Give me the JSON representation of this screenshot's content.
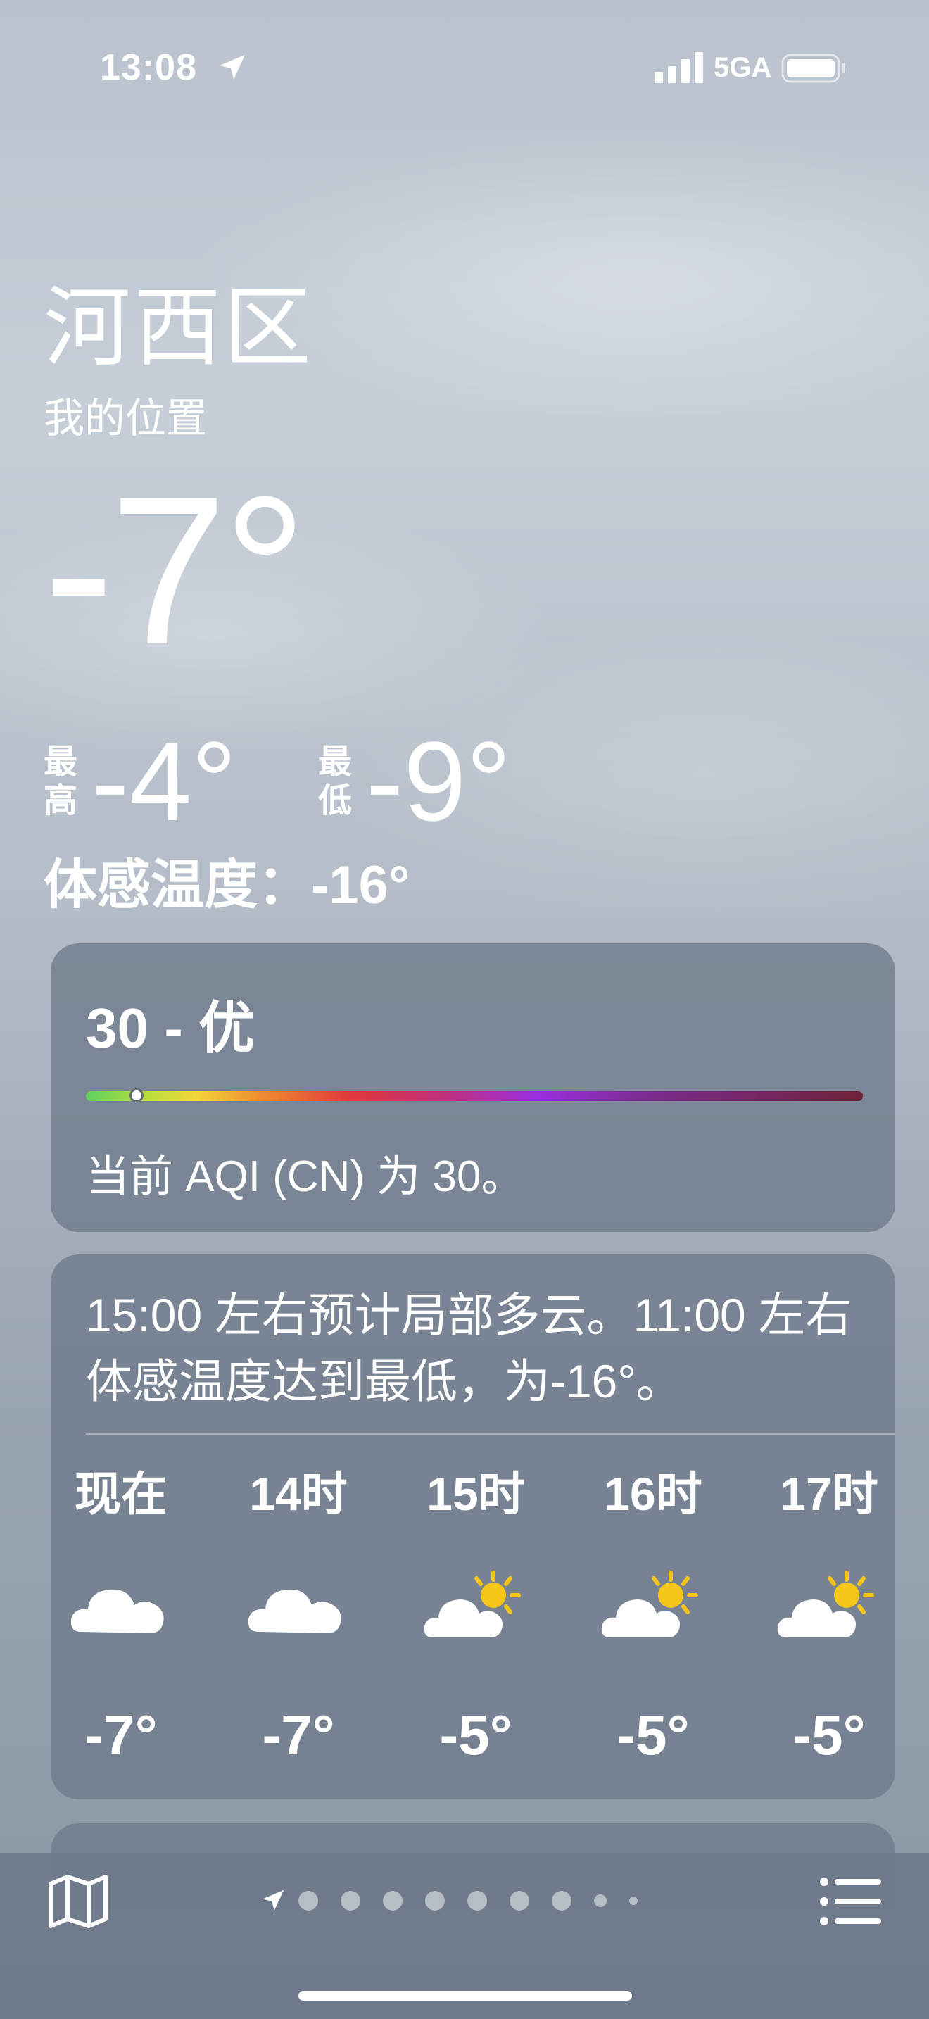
{
  "status_bar": {
    "time": "13:08",
    "network": "5GA",
    "icons": [
      "location-arrow-icon",
      "cellular-signal-icon",
      "battery-icon"
    ]
  },
  "location": {
    "city": "河西区",
    "subtitle": "我的位置"
  },
  "current": {
    "temperature": "-7°",
    "high_label": "最高",
    "high_label_chars": [
      "最",
      "高"
    ],
    "high": "-4°",
    "low_label": "最低",
    "low_label_chars": [
      "最",
      "低"
    ],
    "low": "-9°",
    "feels_like": "体感温度：-16°"
  },
  "aqi": {
    "value_text": "30 - 优",
    "value": 30,
    "indicator_fraction": 0.065,
    "description": "当前 AQI (CN) 为 30。",
    "gradient_colors": [
      "#5fd060",
      "#f1d63a",
      "#f0902f",
      "#e0383b",
      "#9a2fe0",
      "#6d2239"
    ]
  },
  "hourly": {
    "summary": "15:00 左右预计局部多云。11:00 左右体感温度达到最低，为-16°。",
    "hours": [
      {
        "label": "现在",
        "icon": "cloud-icon",
        "temp": "-7°"
      },
      {
        "label": "14时",
        "icon": "cloud-icon",
        "temp": "-7°"
      },
      {
        "label": "15时",
        "icon": "partly-sunny-icon",
        "temp": "-5°"
      },
      {
        "label": "16时",
        "icon": "partly-sunny-icon",
        "temp": "-5°"
      },
      {
        "label": "17时",
        "icon": "partly-sunny-icon",
        "temp": "-5°"
      }
    ]
  },
  "bottom_bar": {
    "icons": [
      "map-icon",
      "location-arrow-icon",
      "list-icon"
    ],
    "page_count": 9,
    "current_page": 1
  },
  "colors": {
    "sky_top": "#b9c2cd",
    "sky_bottom": "#8a96a4",
    "card": "#707c8c",
    "sun": "#f5c518"
  }
}
